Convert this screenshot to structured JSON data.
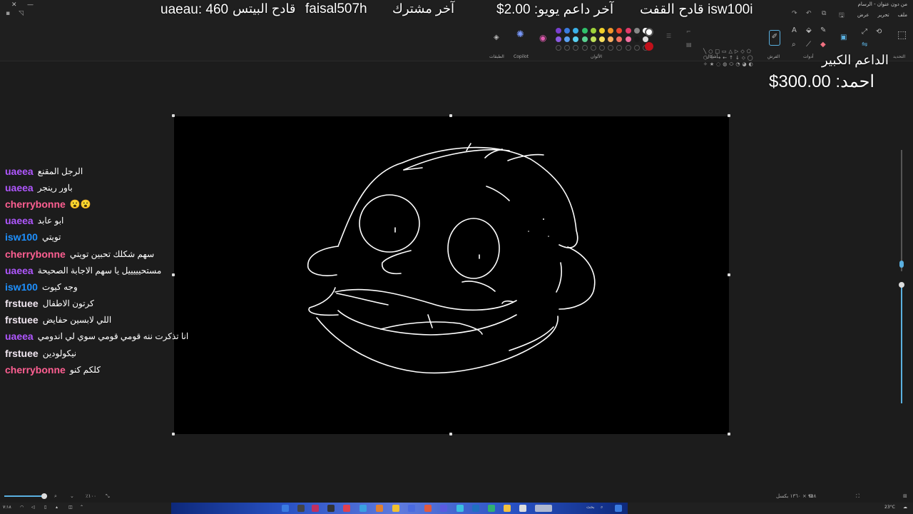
{
  "window": {
    "title": "من دون عنوان - الرسام",
    "menu": [
      "ملف",
      "تحرير",
      "عرض"
    ]
  },
  "ribbon": {
    "groups": {
      "select": "التحديد",
      "tools": "أدوات",
      "brushes": "الفرش",
      "shapes": "أشكال",
      "colors": "الألوان",
      "copilot": "Copilot",
      "layers": "الطبقات"
    },
    "palette_row1": [
      "#7a3fcf",
      "#3a7be0",
      "#3ab0e8",
      "#2fc06a",
      "#9ed23a",
      "#f2d02a",
      "#f0962a",
      "#e8452f",
      "#e23a6a",
      "#888888",
      "#ffffff"
    ],
    "palette_row2": [
      "#8a5ae0",
      "#5aa0f0",
      "#5ad0f0",
      "#5ad090",
      "#c0e05a",
      "#f8e060",
      "#f8b060",
      "#f07060",
      "#f070a0",
      "#1a1a1a",
      "#dddddd"
    ],
    "primary_color": "#ffffff",
    "secondary_color": "#c0101a"
  },
  "overlay": {
    "top_gifter": "قادح القفت isw100i",
    "last_donor": "آخر داعم  يويو: 2.00$",
    "last_sub_label": "آخر مشترك",
    "last_sub_user": "faisal507h",
    "top_bits": "قادح البيتس",
    "top_bits_value": "uaeau: 460",
    "big_donor_label": "الداعم الكبير",
    "big_donor_value": "احمد: 300.00$"
  },
  "chat": [
    {
      "user": "uaeea",
      "color": "#b057ff",
      "msg": "الرجل المقنع"
    },
    {
      "user": "uaeea",
      "color": "#b057ff",
      "msg": "باور رينجر"
    },
    {
      "user": "cherrybonne",
      "color": "#ff5f92",
      "msg": "😮😮"
    },
    {
      "user": "uaeea",
      "color": "#b057ff",
      "msg": "ابو عابد"
    },
    {
      "user": "isw100",
      "color": "#1e90ff",
      "msg": "تويتي"
    },
    {
      "user": "cherrybonne",
      "color": "#ff5f92",
      "msg": "سهم شكلك تحبين تويتي"
    },
    {
      "user": "uaeea",
      "color": "#b057ff",
      "msg": "مستحيييييل يا سهم الاجابة الصحيحة"
    },
    {
      "user": "isw100",
      "color": "#1e90ff",
      "msg": "وجه كيوت"
    },
    {
      "user": "frstuee",
      "color": "#f0e6f0",
      "msg": "كرتون الاطفال"
    },
    {
      "user": "frstuee",
      "color": "#f0e6f0",
      "msg": "اللي لابسين حفايض"
    },
    {
      "user": "uaeea",
      "color": "#b057ff",
      "msg": "انا تذكرت ننه قومي قومي سوي لي اندومي"
    },
    {
      "user": "frstuee",
      "color": "#f0e6f0",
      "msg": "نيكولودين"
    },
    {
      "user": "cherrybonne",
      "color": "#ff5f92",
      "msg": "كلكم كنو"
    }
  ],
  "status": {
    "dims": "٩٥٨ × ١٣٦٠ بكسل",
    "zoom": "٪١٠٠"
  },
  "taskbar": {
    "search": "بحث",
    "weather": "23°C",
    "clock": "٧:١٨"
  }
}
